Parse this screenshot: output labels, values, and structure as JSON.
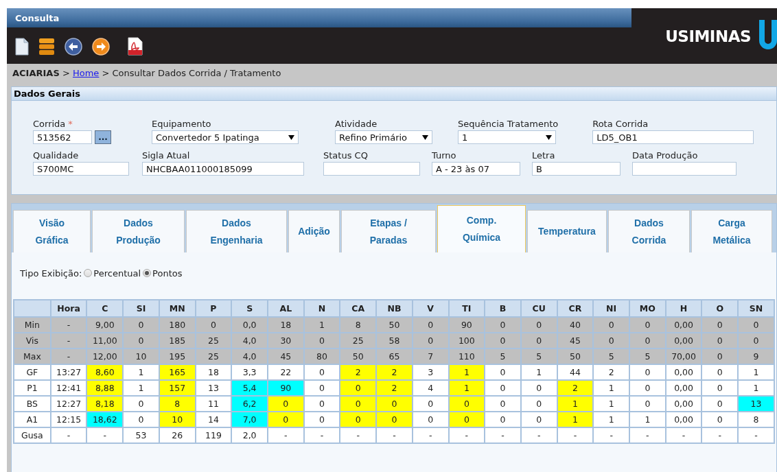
{
  "window": {
    "title": "Consulta"
  },
  "brand": {
    "name": "USIMINAS"
  },
  "breadcrumb": {
    "root": "ACIARIAS",
    "separator_1": ">",
    "link": "Home",
    "separator_2": ">",
    "current": "Consultar Dados Corrida / Tratamento"
  },
  "panel": {
    "title": "Dados Gerais",
    "fields": [
      {
        "label": "Corrida",
        "required_mark": "*",
        "kind": "text",
        "value": "513562",
        "button": "..."
      },
      {
        "label": "Equipamento",
        "kind": "select",
        "value": "Convertedor 5 Ipatinga"
      },
      {
        "label": "Atividade",
        "kind": "select",
        "value": "Refino Primário"
      },
      {
        "label": "Sequência Tratamento",
        "kind": "select",
        "value": "1"
      },
      {
        "label": "Rota Corrida",
        "kind": "text",
        "value": "LD5_OB1"
      },
      {
        "label": "Qualidade",
        "kind": "text",
        "value": "S700MC"
      },
      {
        "label": "Sigla Atual",
        "kind": "text",
        "value": "NHCBAA011000185099"
      },
      {
        "label": "Status CQ",
        "kind": "text"
      },
      {
        "label": "Turno",
        "kind": "text",
        "value": "A - 23 às 07"
      },
      {
        "label": "Letra",
        "kind": "text",
        "value": "B"
      },
      {
        "label": "Data Produção",
        "kind": "text"
      }
    ]
  },
  "tabs": [
    {
      "label": "Visão\nGráfica",
      "selected": false
    },
    {
      "label": "Dados\nProdução",
      "selected": false
    },
    {
      "label": "Dados\nEngenharia",
      "selected": false
    },
    {
      "label": "Adição",
      "selected": false
    },
    {
      "label": "Etapas /\nParadas",
      "selected": false
    },
    {
      "label": "Comp.\nQuímica",
      "selected": true
    },
    {
      "label": "Temperatura",
      "selected": false
    },
    {
      "label": "Dados\nCorrida",
      "selected": false
    },
    {
      "label": "Carga\nMetálica",
      "selected": false
    }
  ],
  "display_type": {
    "label": "Tipo Exibição:",
    "options": [
      {
        "label": "Percentual",
        "selected": false
      },
      {
        "label": "Pontos",
        "selected": true
      }
    ]
  },
  "table": {
    "columns": [
      "Hora",
      "C",
      "SI",
      "MN",
      "P",
      "S",
      "AL",
      "N",
      "CA",
      "NB",
      "V",
      "TI",
      "B",
      "CU",
      "CR",
      "NI",
      "MO",
      "H",
      "O",
      "SN"
    ],
    "rows": [
      {
        "label": "Min",
        "kind": "limit",
        "cells": [
          "-",
          "9,00",
          "0",
          "180",
          "0",
          "0,0",
          "18",
          "1",
          "8",
          "50",
          "0",
          "90",
          "0",
          "0",
          "40",
          "0",
          "0",
          "0,00",
          "0",
          "0"
        ]
      },
      {
        "label": "Vis",
        "kind": "limit",
        "cells": [
          "-",
          "11,00",
          "0",
          "185",
          "25",
          "4,0",
          "30",
          "0",
          "25",
          "58",
          "0",
          "100",
          "0",
          "0",
          "45",
          "0",
          "0",
          "0,00",
          "0",
          "0"
        ]
      },
      {
        "label": "Max",
        "kind": "limit",
        "cells": [
          "-",
          "12,00",
          "10",
          "195",
          "25",
          "4,0",
          "45",
          "80",
          "50",
          "65",
          "7",
          "110",
          "5",
          "5",
          "50",
          "5",
          "5",
          "70,00",
          "0",
          "9"
        ]
      },
      {
        "label": "GF",
        "kind": "sample",
        "cells": [
          "13:27",
          {
            "text": "8,60",
            "color": "#ffff00"
          },
          "1",
          {
            "text": "165",
            "color": "#ffff00"
          },
          "18",
          "3,3",
          "22",
          "0",
          {
            "text": "2",
            "color": "#ffff00"
          },
          {
            "text": "2",
            "color": "#ffff00"
          },
          "3",
          {
            "text": "1",
            "color": "#ffff00"
          },
          "0",
          "1",
          "44",
          "2",
          "0",
          "0,00",
          "0",
          "1"
        ]
      },
      {
        "label": "P1",
        "kind": "sample",
        "cells": [
          "12:41",
          {
            "text": "8,88",
            "color": "#ffff00"
          },
          "1",
          {
            "text": "157",
            "color": "#ffff00"
          },
          "13",
          {
            "text": "5,4",
            "color": "#00ffff"
          },
          {
            "text": "90",
            "color": "#00ffff"
          },
          "0",
          {
            "text": "0",
            "color": "#ffff00"
          },
          {
            "text": "2",
            "color": "#ffff00"
          },
          "4",
          {
            "text": "1",
            "color": "#ffff00"
          },
          "0",
          "0",
          {
            "text": "2",
            "color": "#ffff00"
          },
          "1",
          "0",
          "0,00",
          "0",
          "1"
        ]
      },
      {
        "label": "BS",
        "kind": "sample",
        "cells": [
          "12:27",
          {
            "text": "8,18",
            "color": "#ffff00"
          },
          "0",
          {
            "text": "8",
            "color": "#ffff00"
          },
          "11",
          {
            "text": "6,2",
            "color": "#00ffff"
          },
          {
            "text": "0",
            "color": "#ffff00"
          },
          "0",
          {
            "text": "0",
            "color": "#ffff00"
          },
          {
            "text": "0",
            "color": "#ffff00"
          },
          "0",
          {
            "text": "0",
            "color": "#ffff00"
          },
          "0",
          "0",
          {
            "text": "1",
            "color": "#ffff00"
          },
          "1",
          "0",
          "0,00",
          "0",
          {
            "text": "13",
            "color": "#00ffff"
          }
        ]
      },
      {
        "label": "A1",
        "kind": "sample",
        "cells": [
          "12:15",
          {
            "text": "18,62",
            "color": "#00ffff"
          },
          "0",
          {
            "text": "10",
            "color": "#ffff00"
          },
          "14",
          {
            "text": "7,0",
            "color": "#00ffff"
          },
          {
            "text": "0",
            "color": "#ffff00"
          },
          "0",
          {
            "text": "0",
            "color": "#ffff00"
          },
          {
            "text": "0",
            "color": "#ffff00"
          },
          "0",
          {
            "text": "0",
            "color": "#ffff00"
          },
          "0",
          "0",
          {
            "text": "1",
            "color": "#ffff00"
          },
          "1",
          "1",
          "0,00",
          "0",
          "8"
        ]
      },
      {
        "label": "Gusa",
        "kind": "reference",
        "cells": [
          "-",
          "-",
          "53",
          "26",
          "119",
          "2,0",
          "-",
          "-",
          "-",
          "-",
          "-",
          "-",
          "-",
          "-",
          "-",
          "-",
          "-",
          "-",
          "-",
          "-"
        ]
      }
    ]
  }
}
